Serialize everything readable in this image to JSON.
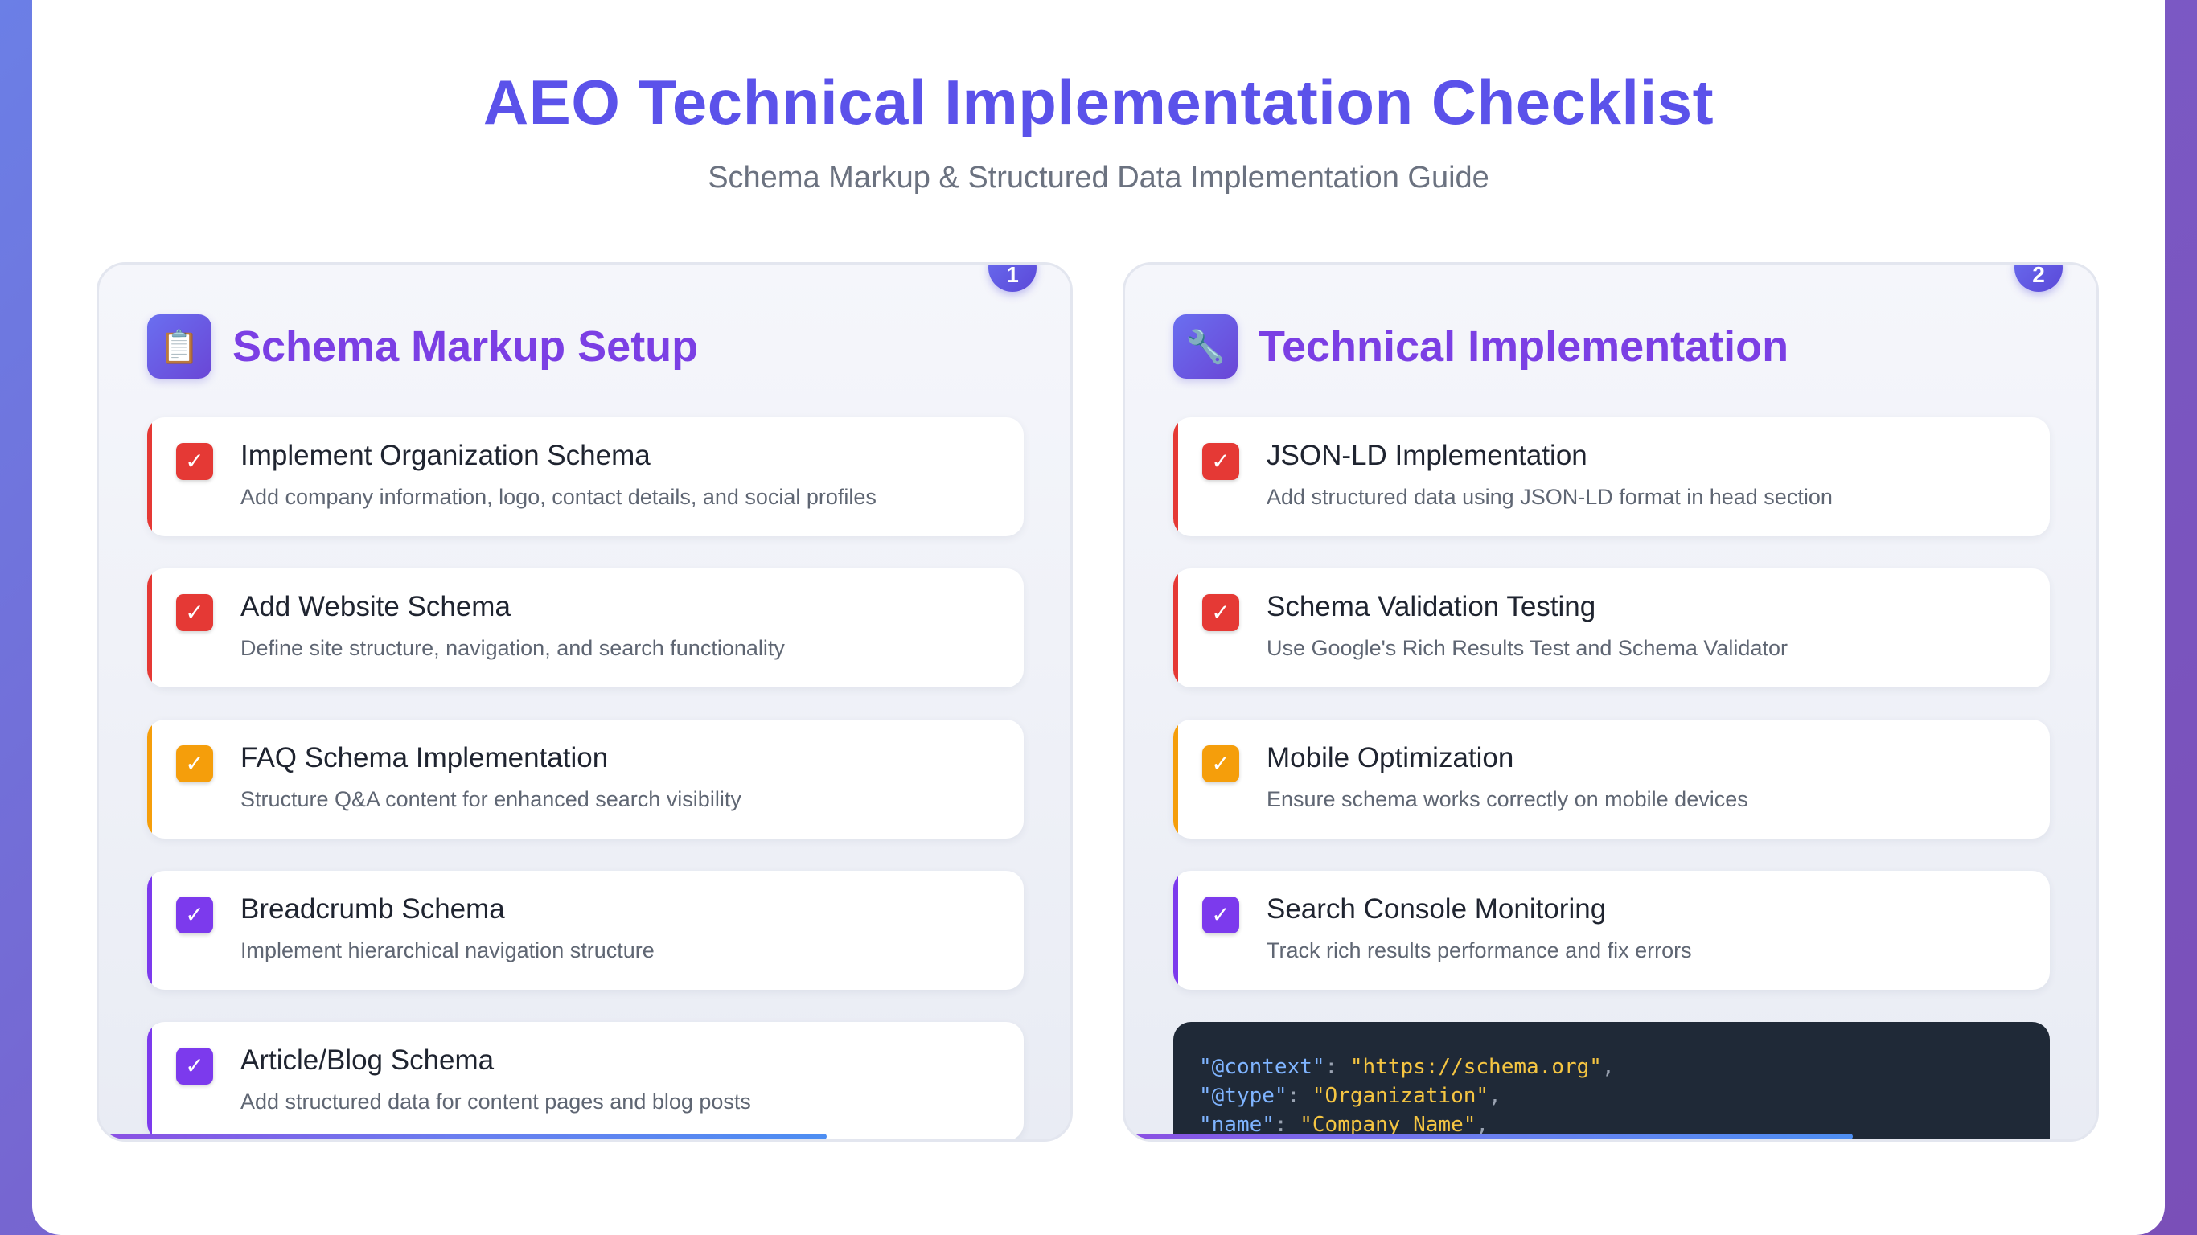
{
  "header": {
    "title": "AEO Technical Implementation Checklist",
    "subtitle": "Schema Markup & Structured Data Implementation Guide"
  },
  "colors": {
    "red": "#e53935",
    "orange": "#f59e0b",
    "purple": "#7c3aed",
    "title": "#5b52ea",
    "panel_title": "#7b3fe4"
  },
  "panels": [
    {
      "number": "1",
      "icon": "clipboard-icon",
      "icon_glyph": "📋",
      "title": "Schema Markup Setup",
      "items": [
        {
          "title": "Implement Organization Schema",
          "desc": "Add company information, logo, contact details, and social profiles",
          "priority": "red"
        },
        {
          "title": "Add Website Schema",
          "desc": "Define site structure, navigation, and search functionality",
          "priority": "red"
        },
        {
          "title": "FAQ Schema Implementation",
          "desc": "Structure Q&A content for enhanced search visibility",
          "priority": "orange"
        },
        {
          "title": "Breadcrumb Schema",
          "desc": "Implement hierarchical navigation structure",
          "priority": "purple"
        },
        {
          "title": "Article/Blog Schema",
          "desc": "Add structured data for content pages and blog posts",
          "priority": "purple"
        }
      ]
    },
    {
      "number": "2",
      "icon": "wrench-icon",
      "icon_glyph": "🔧",
      "title": "Technical Implementation",
      "items": [
        {
          "title": "JSON-LD Implementation",
          "desc": "Add structured data using JSON-LD format in head section",
          "priority": "red"
        },
        {
          "title": "Schema Validation Testing",
          "desc": "Use Google's Rich Results Test and Schema Validator",
          "priority": "red"
        },
        {
          "title": "Mobile Optimization",
          "desc": "Ensure schema works correctly on mobile devices",
          "priority": "orange"
        },
        {
          "title": "Search Console Monitoring",
          "desc": "Track rich results performance and fix errors",
          "priority": "purple"
        }
      ],
      "code_lines": [
        {
          "key": "\"@context\"",
          "val": "\"https://schema.org\""
        },
        {
          "key": "\"@type\"",
          "val": "\"Organization\""
        },
        {
          "key": "\"name\"",
          "val": "\"Company Name\""
        }
      ]
    }
  ],
  "check_glyph": "✓"
}
